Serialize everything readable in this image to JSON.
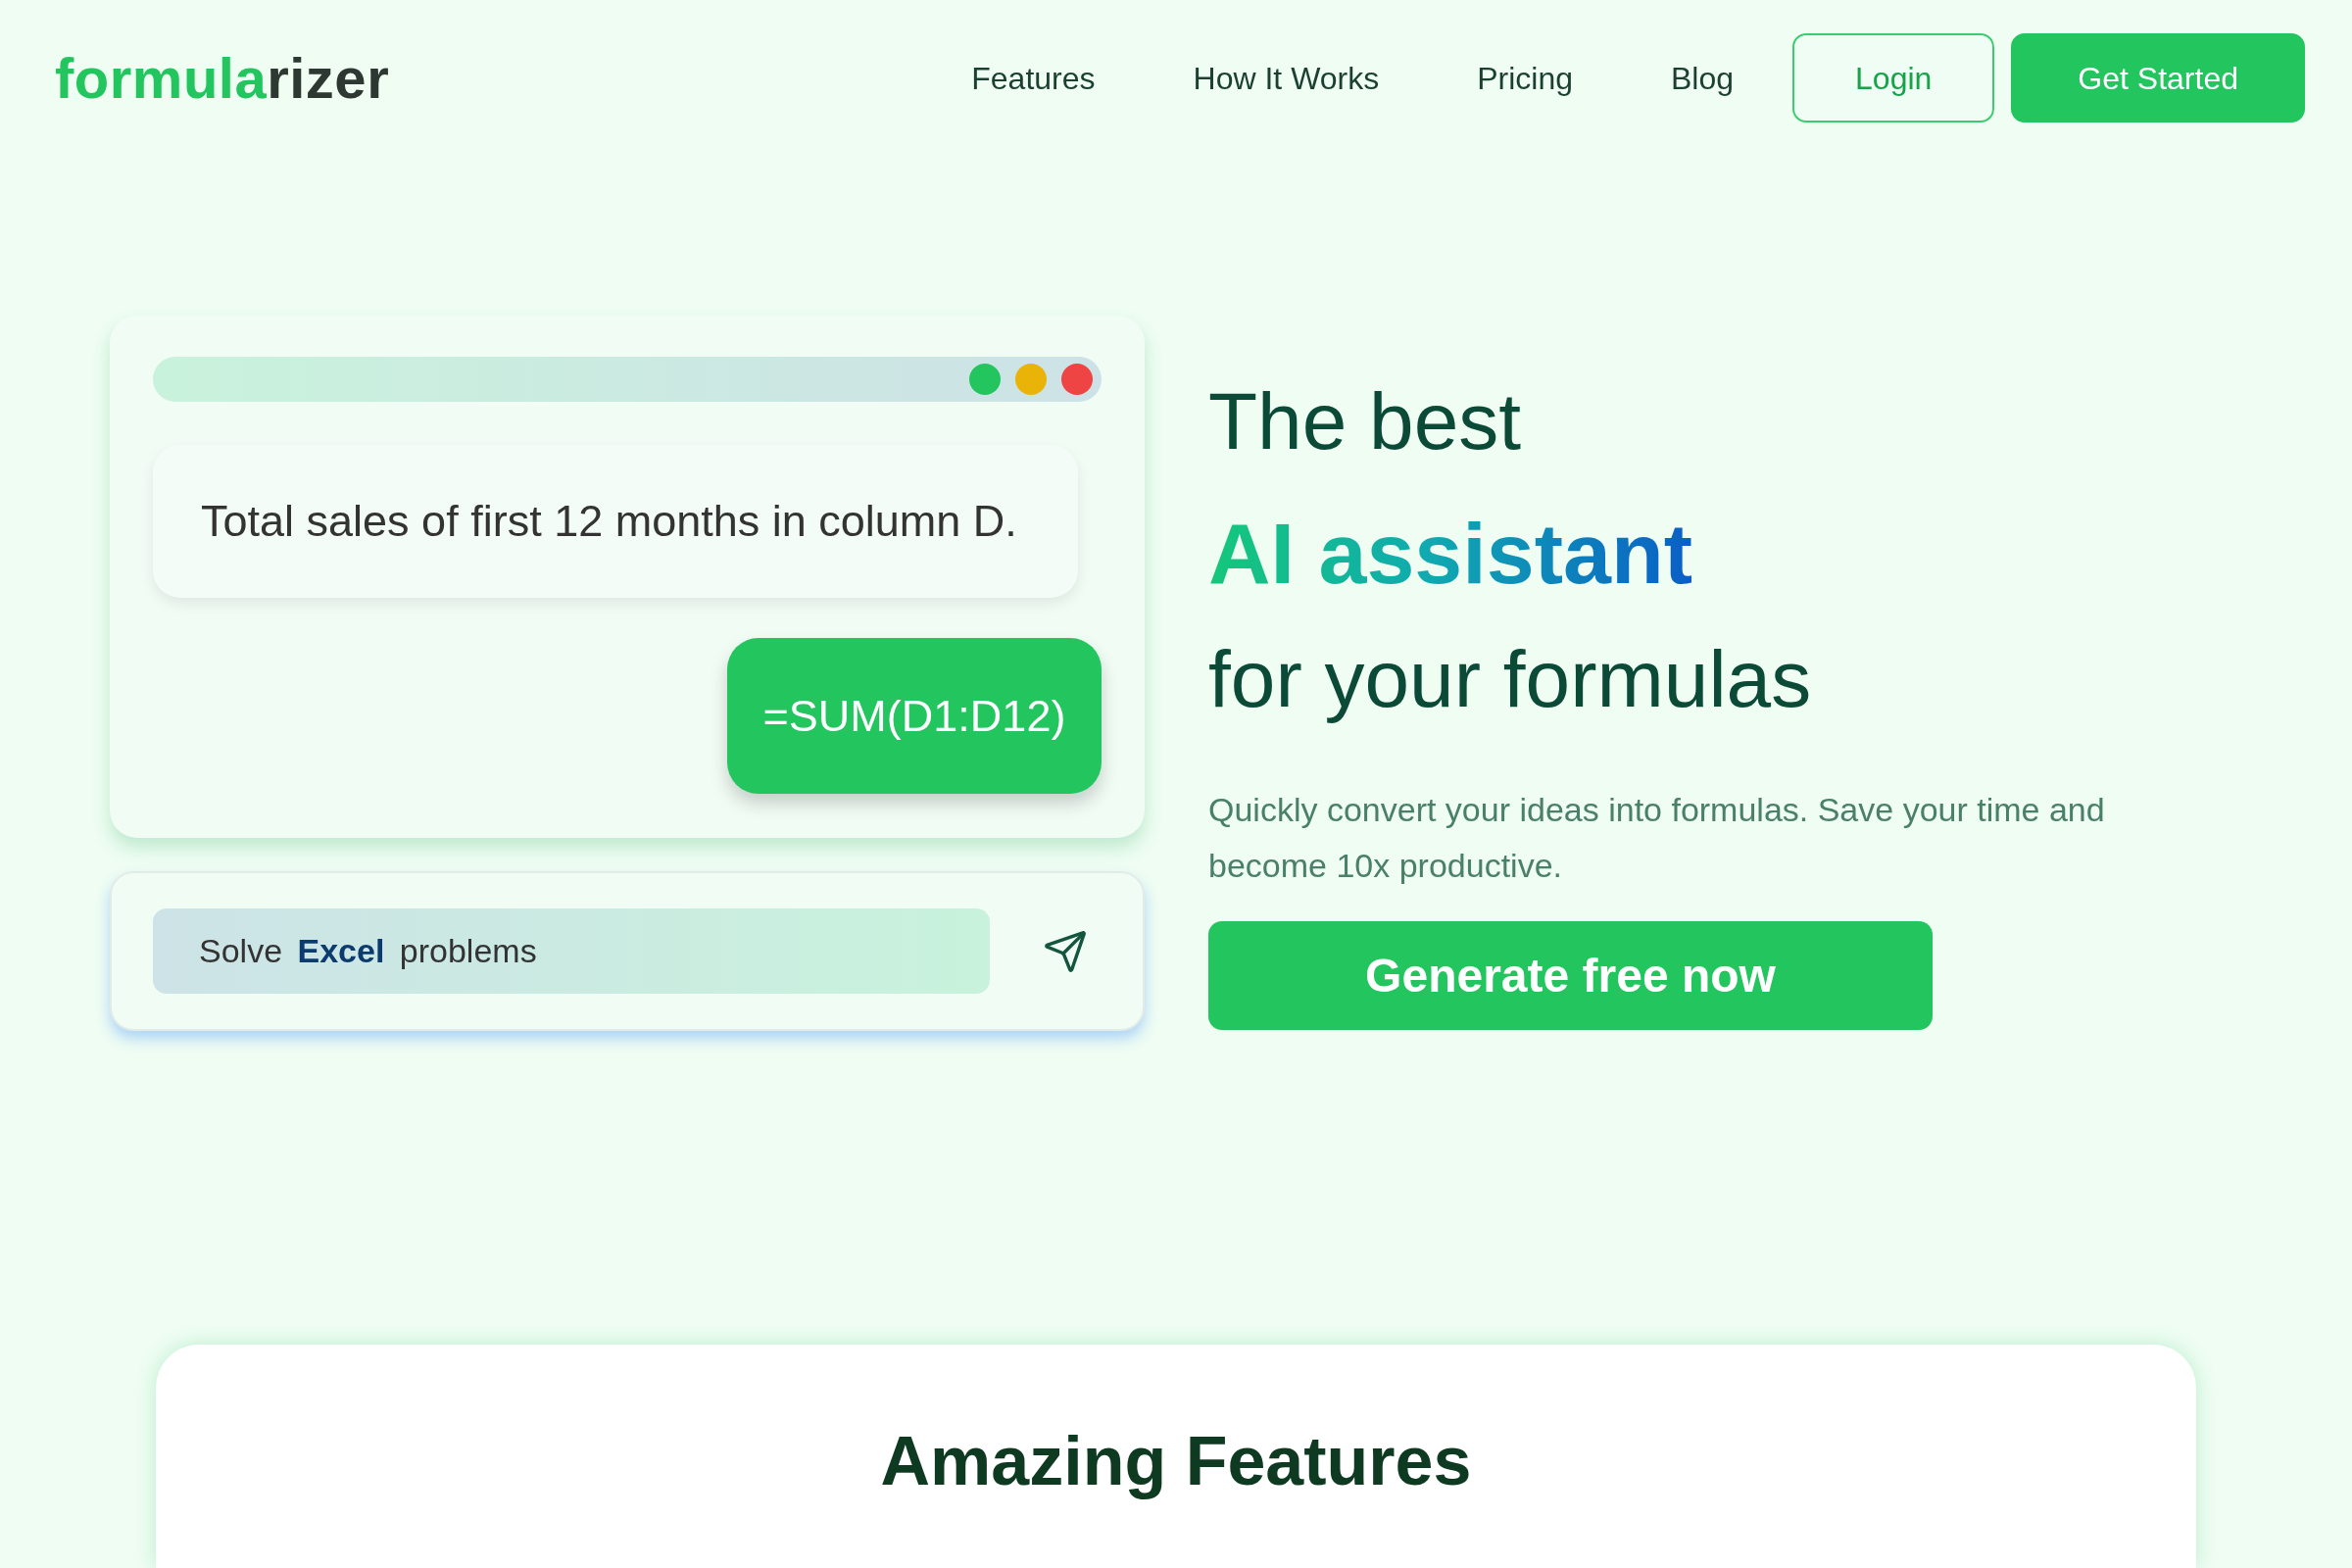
{
  "header": {
    "logo": {
      "accent": "formula",
      "rest": "rizer"
    },
    "nav_links": [
      "Features",
      "How It Works",
      "Pricing",
      "Blog"
    ],
    "buttons": [
      {
        "kind": "outline",
        "label": "Login"
      },
      {
        "kind": "solid",
        "label": "Get Started"
      }
    ]
  },
  "hero": {
    "mockup": {
      "window_dots": [
        {
          "color": "#22c55e"
        },
        {
          "color": "#eab308"
        },
        {
          "color": "#ef4444"
        }
      ],
      "prompt": "Total sales of first 12 months in column D.",
      "formula": "=SUM(D1:D12)",
      "input": {
        "value": "Solve **Excel** problems"
      }
    },
    "headline": {
      "line_1": "The best",
      "highlight": "AI assistant",
      "line_3": "for your formulas"
    },
    "description": "Quickly convert your ideas into formulas. Save your time and become 10x productive.",
    "button": "Generate free now"
  },
  "features": {
    "title": "Amazing Features"
  }
}
